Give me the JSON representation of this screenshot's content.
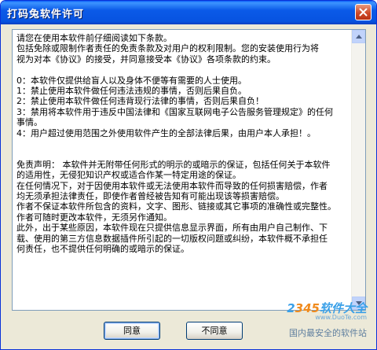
{
  "window": {
    "title": "打码兔软件许可"
  },
  "license": {
    "lines": [
      "请您在使用本软件前仔细阅读如下条款。",
      "包括免除或限制作者责任的免责条款及对用户的权利限制。您的安装使用行为将",
      "视为对本《协议》的接受，并同意接受本《协议》各项条款的约束。",
      "",
      "0：本软件仅提供给盲人以及身体不便等有需要的人士使用。",
      "1：禁止使用本软件做任何违法违规的事情，否则后果自负。",
      "2：禁止使用本软件做任何违背现行法律的事情，否则后果自负！",
      "3：禁用将本软件用于违反中国法律和《国家互联网电子公告服务管理规定》的任何",
      "事情。",
      "4：用户超过使用范围之外使用软件产生的全部法律后果，由用户本人承担！。",
      "",
      "",
      "免责声明： 本软件并无附带任何形式的明示的或暗示的保证，包括任何关于本软件",
      "的适用性，无侵犯知识产权或适合作某一特定用途的保证。",
      "在任何情况下，对于因使用本软件或无法使用本软件而导致的任何损害赔偿，作者",
      "均无须承担法律责任，即使作者曾经被告知有可能出现该等损害赔偿。",
      "作者不保证本软件所包含的资料，文字、图形、链接或其它事项的准确性或完整性。",
      "作者可随时更改本软件，无须另作通知。",
      "此外，出于某些原因，本软件现在只提供信息显示界面，所有由用户自己制作、下",
      "载、使用的第三方信息数据插件所引起的一切版权问题或纠纷，本软件概不承担任",
      "何责任，也不提供任何明确的或暗示的保证。"
    ]
  },
  "buttons": {
    "agree": "同意",
    "disagree": "不同意"
  },
  "watermark": {
    "logo_prefix": "2",
    "logo_num": "345",
    "logo_suffix": "软件大全",
    "url": "www.DuoTe.com",
    "slogan": "国内最安全的软件站"
  },
  "colors": {
    "titlebar": "#0753e0",
    "close": "#cf4a28",
    "dialog_bg": "#ece9d8",
    "textbox_border": "#7f9db9"
  },
  "icons": {
    "close": "close-icon",
    "scroll_up": "arrow-up-icon",
    "scroll_down": "arrow-down-icon"
  }
}
